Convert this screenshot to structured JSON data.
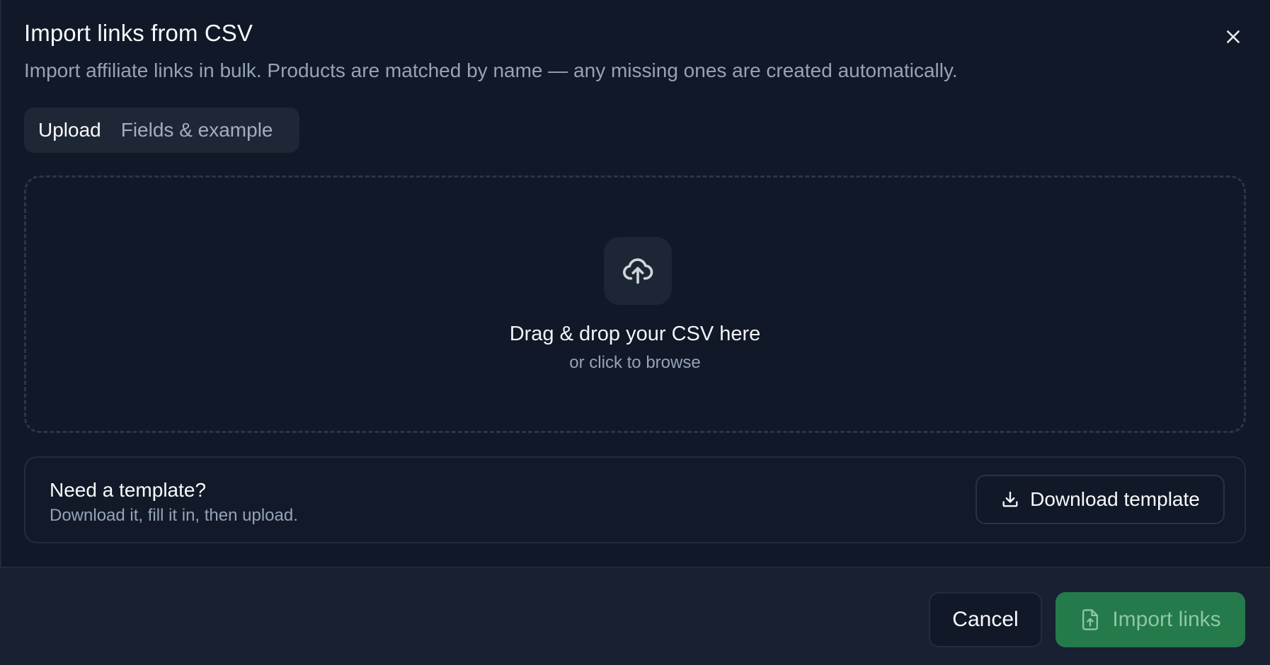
{
  "dialog": {
    "title": "Import links from CSV",
    "subtitle": "Import affiliate links in bulk. Products are matched by name — any missing ones are created automatically.",
    "close_icon": "close-icon"
  },
  "tabs": [
    {
      "label": "Upload",
      "active": true
    },
    {
      "label": "Fields & example",
      "active": false
    }
  ],
  "dropzone": {
    "icon": "cloud-upload-icon",
    "title": "Drag & drop your CSV here",
    "subtitle": "or click to browse"
  },
  "template": {
    "title": "Need a template?",
    "subtitle": "Download it, fill it in, then upload.",
    "button_label": "Download template",
    "button_icon": "download-icon"
  },
  "footer": {
    "cancel_label": "Cancel",
    "import_label": "Import links",
    "import_icon": "file-upload-icon",
    "import_disabled": true
  },
  "colors": {
    "background": "#111827",
    "footer_background": "#182031",
    "primary_button": "#247a4b",
    "muted_text": "#94a3b8"
  }
}
